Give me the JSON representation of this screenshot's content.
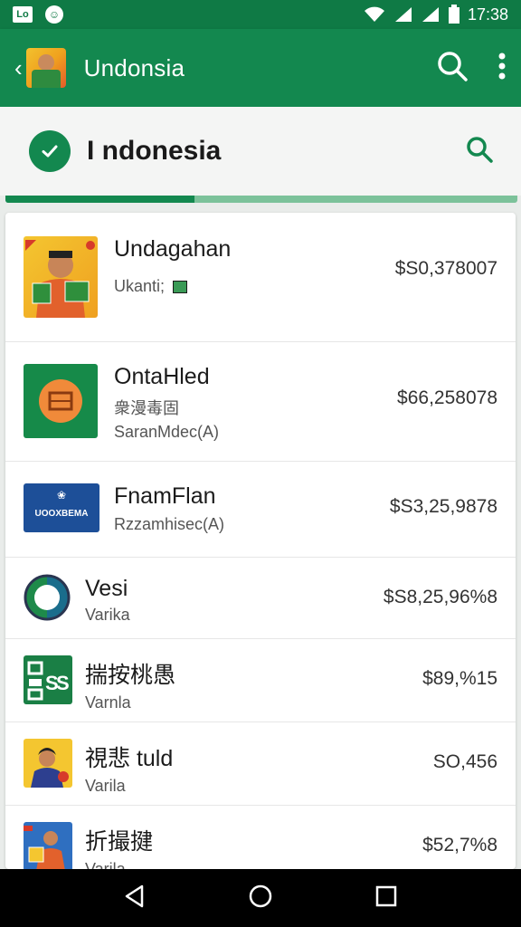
{
  "status_bar": {
    "left_icon_1": "Lo",
    "left_icon_2": "☺",
    "time": "17:38"
  },
  "app_bar": {
    "title": "Undonsia"
  },
  "search_header": {
    "title": "I ndonesia"
  },
  "progress": {
    "fraction": 0.37
  },
  "items": [
    {
      "name": "Undagahan",
      "sub": "Ukanti;",
      "sub2": "",
      "price": "$S0,378007"
    },
    {
      "name": "OntaHled",
      "sub": "衆漫毒固",
      "sub2": "SaranMdec(A)",
      "price": "$66,258078"
    },
    {
      "name": "FnamFlan",
      "sub": "Rzzamhisec(A)",
      "sub2": "",
      "price": "$S3,25,9878",
      "logo_text": "UOOXBEMA"
    },
    {
      "name": "Vesi",
      "sub": "Varika",
      "sub2": "",
      "price": "$S8,25,96%8"
    },
    {
      "name": "揣按桃愚",
      "sub": "Varnla",
      "sub2": "",
      "price": "$89,%15"
    },
    {
      "name": "視悲 tuld",
      "sub": "Varila",
      "sub2": "",
      "price": "SO,456"
    },
    {
      "name": "折撮揵",
      "sub": "Varila",
      "sub2": "",
      "price": "$52,7%8"
    }
  ],
  "colors": {
    "primary": "#13884f",
    "status_bar": "#0f7a45",
    "progress_track": "#7cc29a"
  }
}
